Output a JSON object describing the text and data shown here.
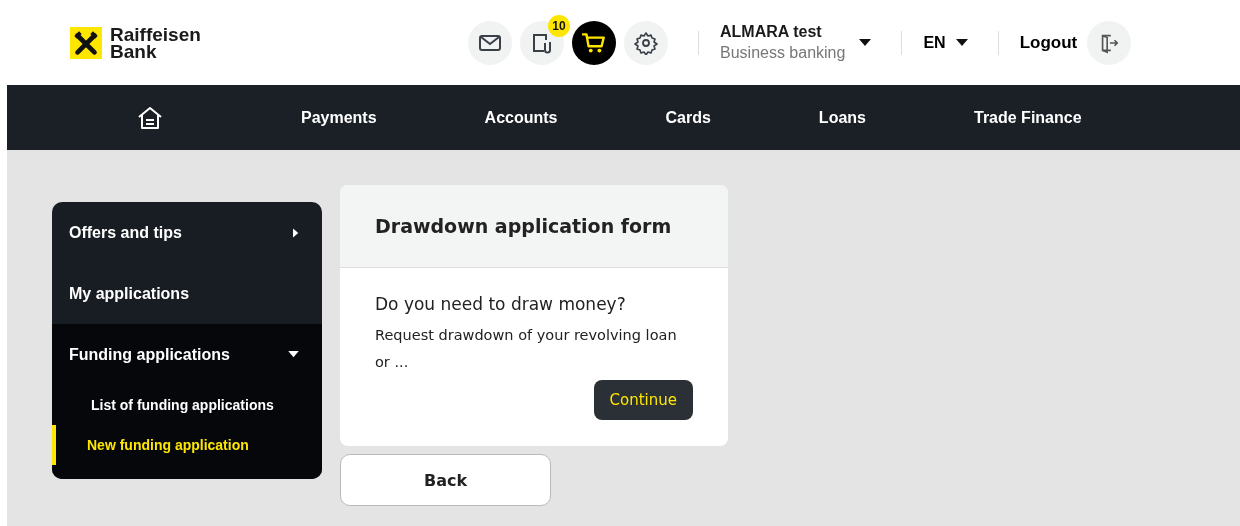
{
  "header": {
    "logo": [
      "Raiffeisen",
      "Bank"
    ],
    "icons": [
      {
        "kind": "mail",
        "selected": false
      },
      {
        "kind": "documents",
        "selected": false,
        "badge": "10"
      },
      {
        "kind": "cart",
        "selected": true
      },
      {
        "kind": "settings",
        "selected": false
      }
    ],
    "user": {
      "name": "ALMARA test",
      "subtitle": "Business banking"
    },
    "language": "EN",
    "logout": "Logout"
  },
  "nav": {
    "items": [
      "Payments",
      "Accounts",
      "Cards",
      "Loans",
      "Trade Finance"
    ]
  },
  "sidebar": {
    "items": [
      {
        "label": "Offers and tips",
        "kind": "link",
        "expanded": false
      },
      {
        "label": "My applications",
        "kind": "plain"
      },
      {
        "label": "Funding applications",
        "kind": "group",
        "expanded": true,
        "children": [
          {
            "label": "List of funding applications",
            "selected": false
          },
          {
            "label": "New funding application",
            "selected": true
          }
        ]
      }
    ]
  },
  "card": {
    "title": "Drawdown application form",
    "question": "Do you need to draw money?",
    "text": "Request drawdown of your revolving loan or ...",
    "button": "Continue"
  },
  "back": "Back"
}
